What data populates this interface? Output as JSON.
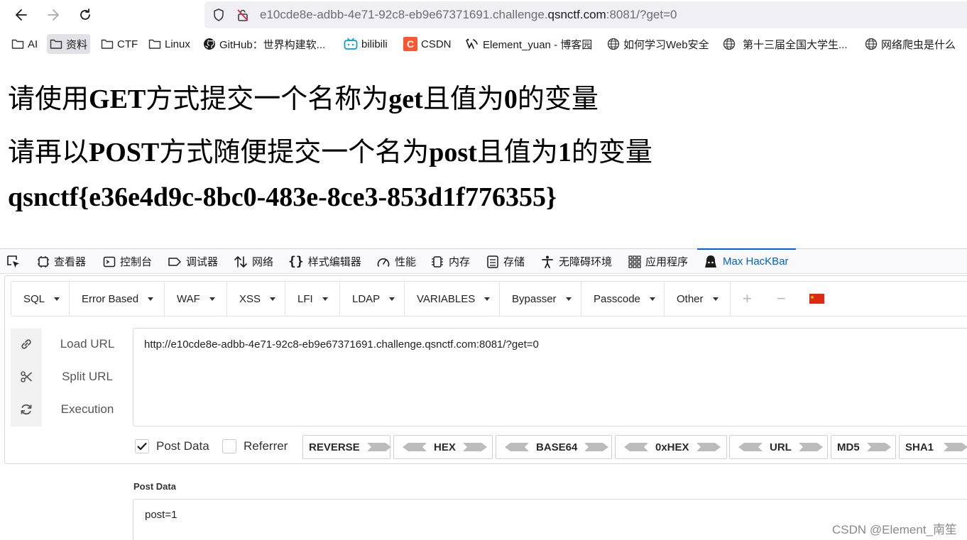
{
  "browser": {
    "url_prefix": "e10cde8e-adbb-4e71-92c8-eb9e67371691.challenge.",
    "url_domain": "qsnctf.com",
    "url_suffix": ":8081/?get=0"
  },
  "bookmarks": [
    {
      "label": "AI",
      "icon": "folder-icon"
    },
    {
      "label": "资料",
      "icon": "folder-icon",
      "active": true
    },
    {
      "label": "CTF",
      "icon": "folder-icon"
    },
    {
      "label": "Linux",
      "icon": "folder-icon"
    },
    {
      "label": "GitHub：世界构建软...",
      "icon": "github-icon"
    },
    {
      "label": "bilibili",
      "icon": "bilibili-icon"
    },
    {
      "label": "CSDN",
      "icon": "csdn-icon"
    },
    {
      "label": "Element_yuan - 博客园",
      "icon": "cnblogs-icon"
    },
    {
      "label": "如何学习Web安全",
      "icon": "globe-icon"
    },
    {
      "label": "第十三届全国大学生...",
      "icon": "globe-icon"
    },
    {
      "label": "网络爬虫是什么",
      "icon": "globe-icon"
    }
  ],
  "page": {
    "line1": {
      "p1": "请使用",
      "b1": "GET",
      "p2": "方式提交一个名称为",
      "b2": "get",
      "p3": "且值为",
      "b3": "0",
      "p4": "的变量"
    },
    "line2": {
      "p1": "请再以",
      "b1": "POST",
      "p2": "方式随便提交一个名为",
      "b2": "post",
      "p3": "且值为",
      "b3": "1",
      "p4": "的变量"
    },
    "flag": "qsnctf{e36e4d9c-8bc0-483e-8ce3-853d1f776355}"
  },
  "devtools": {
    "tabs": [
      {
        "label": "查看器"
      },
      {
        "label": "控制台"
      },
      {
        "label": "调试器"
      },
      {
        "label": "网络"
      },
      {
        "label": "样式编辑器"
      },
      {
        "label": "性能"
      },
      {
        "label": "内存"
      },
      {
        "label": "存储"
      },
      {
        "label": "无障碍环境"
      },
      {
        "label": "应用程序"
      },
      {
        "label": "Max HacKBar",
        "selected": true
      }
    ]
  },
  "hackbar": {
    "menu": [
      "SQL",
      "Error Based",
      "WAF",
      "XSS",
      "LFI",
      "LDAP",
      "VARIABLES",
      "Bypasser",
      "Passcode",
      "Other"
    ],
    "plus": "+",
    "minus": "−",
    "actions": [
      "Load URL",
      "Split URL",
      "Execution"
    ],
    "url_value": "http://e10cde8e-adbb-4e71-92c8-eb9e67371691.challenge.qsnctf.com:8081/?get=0",
    "post_data_checked": true,
    "post_data_label": "Post Data",
    "referrer_checked": false,
    "referrer_label": "Referrer",
    "encoders": [
      "REVERSE",
      "HEX",
      "BASE64",
      "0xHEX",
      "URL",
      "MD5",
      "SHA1"
    ],
    "post_section_label": "Post Data",
    "post_value": "post=1"
  },
  "watermark": "CSDN @Element_南笙",
  "colors": {
    "accent": "#0061e0",
    "flag_icon": "#de2910"
  }
}
